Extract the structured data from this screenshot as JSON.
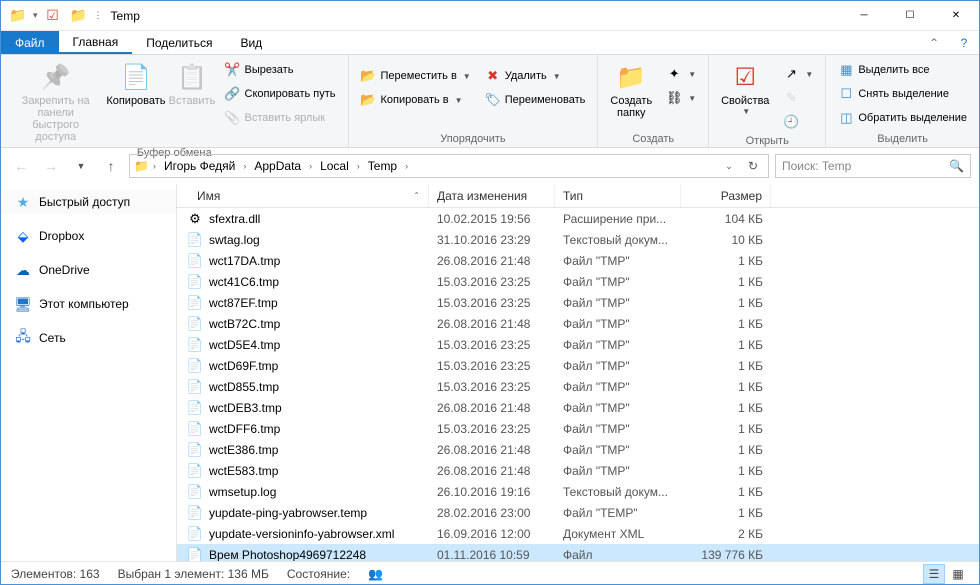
{
  "title": "Temp",
  "tabs": {
    "file": "Файл",
    "home": "Главная",
    "share": "Поделиться",
    "view": "Вид"
  },
  "ribbon": {
    "clipboard": {
      "label": "Буфер обмена",
      "pin": "Закрепить на панели\nбыстрого доступа",
      "copy": "Копировать",
      "paste": "Вставить",
      "cut": "Вырезать",
      "copy_path": "Скопировать путь",
      "paste_shortcut": "Вставить ярлык"
    },
    "organize": {
      "label": "Упорядочить",
      "move_to": "Переместить в",
      "copy_to": "Копировать в",
      "delete": "Удалить",
      "rename": "Переименовать"
    },
    "new": {
      "label": "Создать",
      "new_folder": "Создать\nпапку"
    },
    "open": {
      "label": "Открыть",
      "properties": "Свойства"
    },
    "select": {
      "label": "Выделить",
      "select_all": "Выделить все",
      "select_none": "Снять выделение",
      "invert": "Обратить выделение"
    }
  },
  "breadcrumb": [
    "Игорь Федяй",
    "AppData",
    "Local",
    "Temp"
  ],
  "search_placeholder": "Поиск: Temp",
  "nav": {
    "quick": "Быстрый доступ",
    "dropbox": "Dropbox",
    "onedrive": "OneDrive",
    "thispc": "Этот компьютер",
    "network": "Сеть"
  },
  "columns": {
    "name": "Имя",
    "date": "Дата изменения",
    "type": "Тип",
    "size": "Размер"
  },
  "files": [
    {
      "name": "sfextra.dll",
      "date": "10.02.2015 19:56",
      "type": "Расширение при...",
      "size": "104 КБ",
      "icon": "dll"
    },
    {
      "name": "swtag.log",
      "date": "31.10.2016 23:29",
      "type": "Текстовый докум...",
      "size": "10 КБ",
      "icon": "txt"
    },
    {
      "name": "wct17DA.tmp",
      "date": "26.08.2016 21:48",
      "type": "Файл \"TMP\"",
      "size": "1 КБ",
      "icon": "file"
    },
    {
      "name": "wct41C6.tmp",
      "date": "15.03.2016 23:25",
      "type": "Файл \"TMP\"",
      "size": "1 КБ",
      "icon": "file"
    },
    {
      "name": "wct87EF.tmp",
      "date": "15.03.2016 23:25",
      "type": "Файл \"TMP\"",
      "size": "1 КБ",
      "icon": "file"
    },
    {
      "name": "wctB72C.tmp",
      "date": "26.08.2016 21:48",
      "type": "Файл \"TMP\"",
      "size": "1 КБ",
      "icon": "file"
    },
    {
      "name": "wctD5E4.tmp",
      "date": "15.03.2016 23:25",
      "type": "Файл \"TMP\"",
      "size": "1 КБ",
      "icon": "file"
    },
    {
      "name": "wctD69F.tmp",
      "date": "15.03.2016 23:25",
      "type": "Файл \"TMP\"",
      "size": "1 КБ",
      "icon": "file"
    },
    {
      "name": "wctD855.tmp",
      "date": "15.03.2016 23:25",
      "type": "Файл \"TMP\"",
      "size": "1 КБ",
      "icon": "file"
    },
    {
      "name": "wctDEB3.tmp",
      "date": "26.08.2016 21:48",
      "type": "Файл \"TMP\"",
      "size": "1 КБ",
      "icon": "file"
    },
    {
      "name": "wctDFF6.tmp",
      "date": "15.03.2016 23:25",
      "type": "Файл \"TMP\"",
      "size": "1 КБ",
      "icon": "file"
    },
    {
      "name": "wctE386.tmp",
      "date": "26.08.2016 21:48",
      "type": "Файл \"TMP\"",
      "size": "1 КБ",
      "icon": "file"
    },
    {
      "name": "wctE583.tmp",
      "date": "26.08.2016 21:48",
      "type": "Файл \"TMP\"",
      "size": "1 КБ",
      "icon": "file"
    },
    {
      "name": "wmsetup.log",
      "date": "26.10.2016 19:16",
      "type": "Текстовый докум...",
      "size": "1 КБ",
      "icon": "txt"
    },
    {
      "name": "yupdate-ping-yabrowser.temp",
      "date": "28.02.2016 23:00",
      "type": "Файл \"TEMP\"",
      "size": "1 КБ",
      "icon": "file"
    },
    {
      "name": "yupdate-versioninfo-yabrowser.xml",
      "date": "16.09.2016 12:00",
      "type": "Документ XML",
      "size": "2 КБ",
      "icon": "file"
    },
    {
      "name": "Врем Photoshop4969712248",
      "date": "01.11.2016 10:59",
      "type": "Файл",
      "size": "139 776 КБ",
      "icon": "file",
      "selected": true
    }
  ],
  "status": {
    "count": "Элементов: 163",
    "selected": "Выбран 1 элемент: 136 МБ",
    "state": "Состояние:"
  }
}
